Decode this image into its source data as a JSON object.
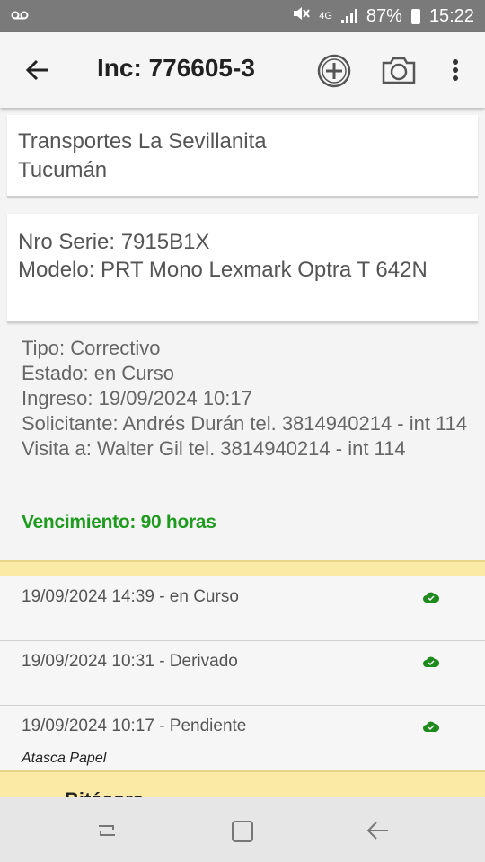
{
  "status_bar": {
    "voicemail_icon": "voicemail-icon",
    "network": "4G",
    "battery": "87%",
    "time": "15:22"
  },
  "app_bar": {
    "title": "Inc: 776605-3",
    "icons": [
      "back-arrow-icon",
      "add-circle-icon",
      "camera-icon",
      "more-vert-icon"
    ]
  },
  "client": {
    "name": "Transportes La Sevillanita",
    "location": "Tucumán"
  },
  "equipment": {
    "serial": "Nro Serie: 7915B1X",
    "model": "Modelo: PRT Mono Lexmark Optra T 642N"
  },
  "details": {
    "tipo": "Tipo: Correctivo",
    "estado": "Estado: en Curso",
    "ingreso": "Ingreso: 19/09/2024 10:17",
    "solicitante": "Solicitante: Andrés Durán tel. 3814940214 - int 114",
    "visita": "Visita a: Walter Gil tel. 3814940214 - int 114",
    "vencimiento": "Vencimiento: 90 horas"
  },
  "history": [
    {
      "text": "19/09/2024 14:39 - en Curso",
      "note": "",
      "icon": "cloud-check-icon"
    },
    {
      "text": "19/09/2024 10:31 - Derivado",
      "note": "",
      "icon": "cloud-check-icon"
    },
    {
      "text": "19/09/2024 10:17 - Pendiente",
      "note": "Atasca Papel",
      "icon": "cloud-check-icon"
    }
  ],
  "bitacora": {
    "label": "Bitácora"
  },
  "colors": {
    "accent_green": "#1e9b1e",
    "divider_yellow": "#fbe9a6",
    "status_bar": "#7a7a7a"
  }
}
